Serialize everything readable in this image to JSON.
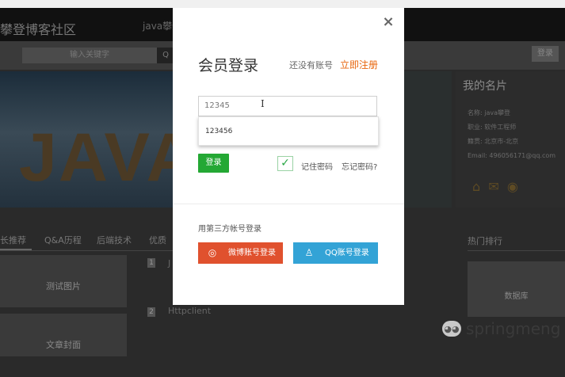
{
  "background": {
    "site_title": "攀登博客社区",
    "nav": [
      "java攀登"
    ],
    "search_placeholder": "输入关键字",
    "search_button": "Q",
    "login_button": "登录",
    "banner_text": "JAVA",
    "profile_card": {
      "title": "我的名片",
      "lines": [
        "名称: java攀登",
        "职业: 软件工程师",
        "籍贯: 北京市-北京",
        "Email: 496056171@qq.com"
      ]
    },
    "tabs": [
      "长推荐",
      "Q&A历程",
      "后端技术",
      "优质"
    ],
    "thumbnails": [
      "测试图片",
      "文章封面"
    ],
    "list_items": [
      "J",
      "Httpclient"
    ],
    "ranking_title": "热门排行",
    "ranking_caption": "数据库"
  },
  "modal": {
    "title": "会员登录",
    "no_account": "还没有账号",
    "register_link": "立即注册",
    "username_value": "12345",
    "suggestion": "123456",
    "login_button": "登录",
    "remember_label": "记住密码",
    "forgot_label": "忘记密码?",
    "third_party_label": "用第三方帐号登录",
    "weibo_button": "微博账号登录",
    "qq_button": "QQ账号登录",
    "close_icon": "×"
  },
  "watermark": {
    "text": "springmeng"
  },
  "colors": {
    "green": "#24a834",
    "weibo": "#e0512e",
    "qq": "#33a3d6",
    "register": "#e8650c"
  }
}
